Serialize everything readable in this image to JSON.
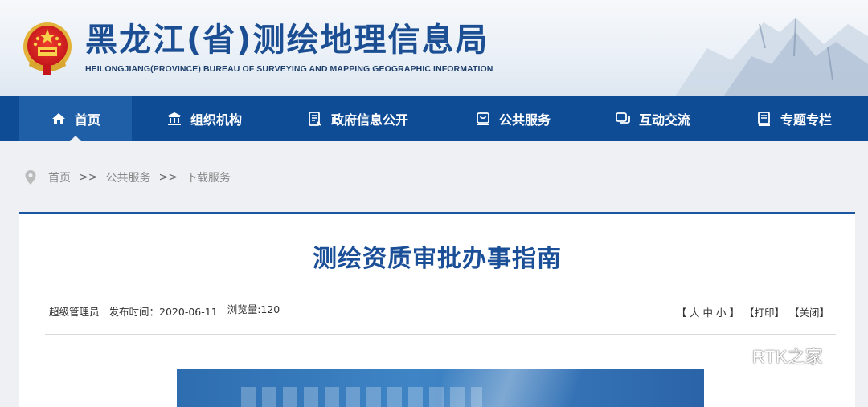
{
  "header": {
    "title_cn": "黑龙江(省)测绘地理信息局",
    "title_en": "HEILONGJIANG(PROVINCE) BUREAU OF SURVEYING AND MAPPING GEOGRAPHIC INFORMATION"
  },
  "nav": {
    "items": [
      {
        "label": "首页",
        "icon": "home-icon"
      },
      {
        "label": "组织机构",
        "icon": "building-icon"
      },
      {
        "label": "政府信息公开",
        "icon": "document-icon"
      },
      {
        "label": "公共服务",
        "icon": "service-icon"
      },
      {
        "label": "互动交流",
        "icon": "chat-icon"
      },
      {
        "label": "专题专栏",
        "icon": "book-icon"
      }
    ],
    "active_index": 0
  },
  "breadcrumb": {
    "items": [
      "首页",
      "公共服务",
      "下载服务"
    ],
    "separator": ">>"
  },
  "article": {
    "title": "测绘资质审批办事指南",
    "author": "超级管理员",
    "publish_label": "发布时间：",
    "publish_date": "2020-06-11",
    "views_label": "浏览量:",
    "views": "120",
    "font_size_label": "【 大 中 小 】",
    "print_label": "【打印】",
    "close_label": "【关闭】"
  },
  "watermark": {
    "text": "RTK之家"
  },
  "colors": {
    "nav_bg": "#0f4c96",
    "nav_active": "#1f5fa8",
    "title_blue": "#1b4f97",
    "page_bg": "#eef0f3"
  }
}
